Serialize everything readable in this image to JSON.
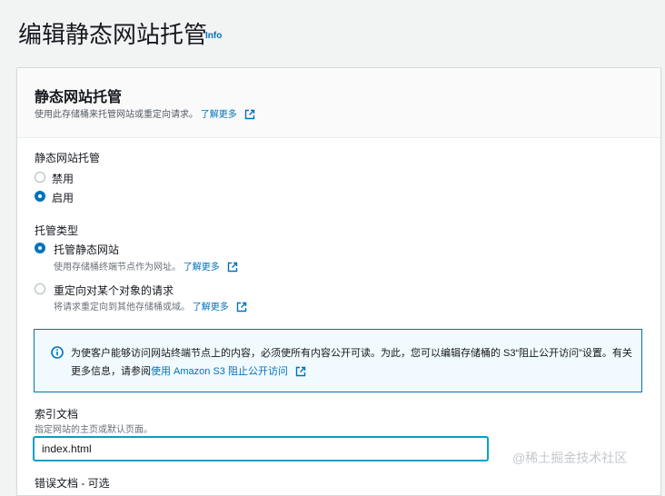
{
  "page": {
    "title": "编辑静态网站托管",
    "info_label": "Info"
  },
  "panel": {
    "title": "静态网站托管",
    "description": "使用此存储桶来托管网站或重定向请求。",
    "learn_more": "了解更多"
  },
  "hosting": {
    "label": "静态网站托管",
    "options": [
      {
        "label": "禁用",
        "checked": false
      },
      {
        "label": "启用",
        "checked": true
      }
    ]
  },
  "hosting_type": {
    "label": "托管类型",
    "options": [
      {
        "label": "托管静态网站",
        "description": "使用存储桶终端节点作为网址。",
        "learn_more": "了解更多",
        "checked": true
      },
      {
        "label": "重定向对某个对象的请求",
        "description": "将请求重定向到其他存储桶或域。",
        "learn_more": "了解更多",
        "checked": false
      }
    ]
  },
  "alert": {
    "text": "为使客户能够访问网站终端节点上的内容，必须使所有内容公开可读。为此，您可以编辑存储桶的 S3“阻止公开访问”设置。有关更多信息，请参阅",
    "link": "使用 Amazon S3 阻止公开访问"
  },
  "index_document": {
    "label": "索引文档",
    "description": "指定网站的主页或默认页面。",
    "value": "index.html"
  },
  "error_document": {
    "label": "错误文档 - 可选"
  },
  "watermark": "@稀土掘金技术社区",
  "colors": {
    "link": "#0073bb",
    "focus": "#00a1c9",
    "alert_bg": "#f1faff"
  }
}
